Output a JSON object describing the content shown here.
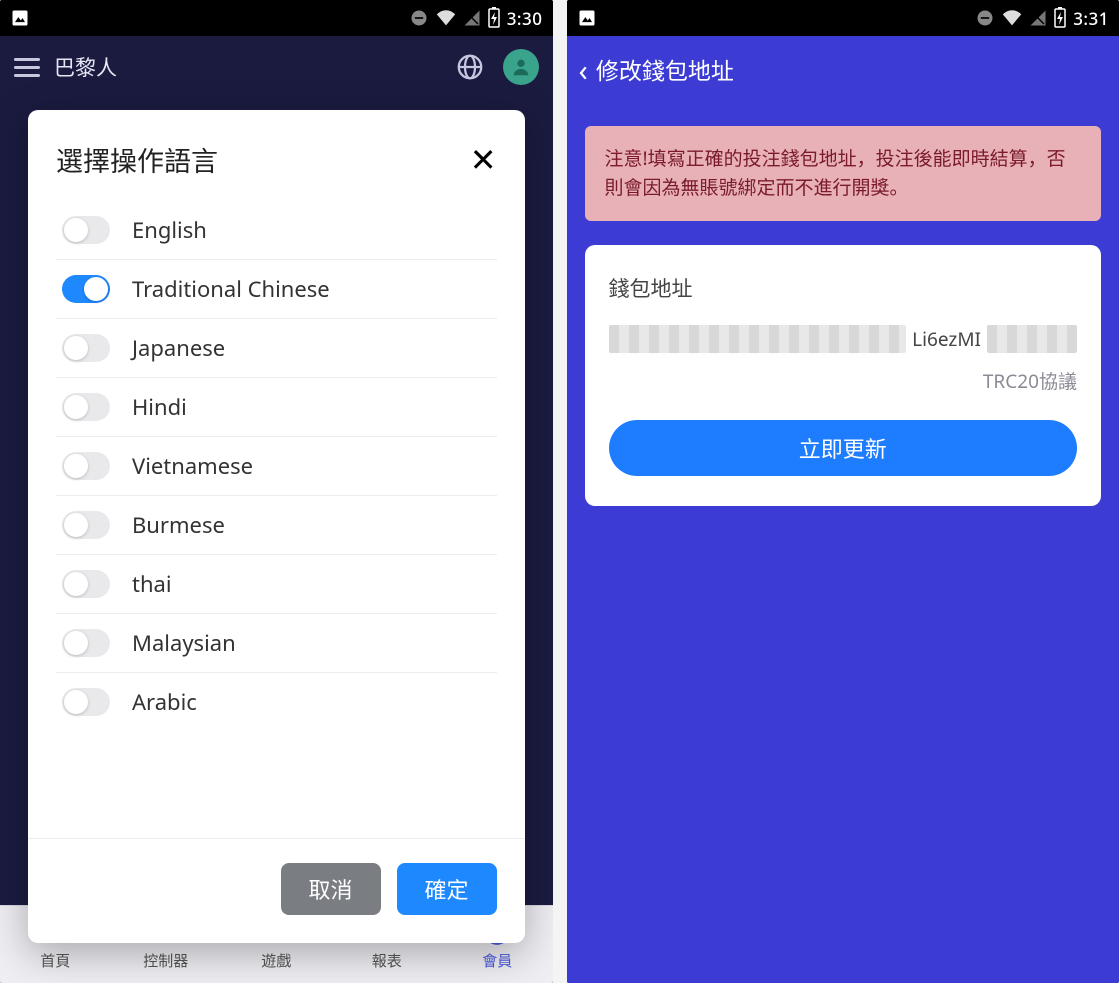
{
  "screen1": {
    "status": {
      "time": "3:30"
    },
    "header": {
      "app_name": "巴黎人"
    },
    "modal": {
      "title": "選擇操作語言",
      "languages": [
        {
          "label": "English",
          "on": false
        },
        {
          "label": "Traditional Chinese",
          "on": true
        },
        {
          "label": "Japanese",
          "on": false
        },
        {
          "label": "Hindi",
          "on": false
        },
        {
          "label": "Vietnamese",
          "on": false
        },
        {
          "label": "Burmese",
          "on": false
        },
        {
          "label": "thai",
          "on": false
        },
        {
          "label": "Malaysian",
          "on": false
        },
        {
          "label": "Arabic",
          "on": false
        }
      ],
      "cancel": "取消",
      "confirm": "確定"
    },
    "tabs": [
      {
        "label": "首頁",
        "icon": "home",
        "active": false
      },
      {
        "label": "控制器",
        "icon": "controller",
        "active": false
      },
      {
        "label": "遊戲",
        "icon": "gamepad",
        "active": false
      },
      {
        "label": "報表",
        "icon": "chart",
        "active": false
      },
      {
        "label": "會員",
        "icon": "user",
        "active": true
      }
    ]
  },
  "screen2": {
    "status": {
      "time": "3:31"
    },
    "page_title": "修改錢包地址",
    "notice": "注意!填寫正確的投注錢包地址，投注後能即時結算，否則會因為無賬號綁定而不進行開獎。",
    "wallet": {
      "label": "錢包地址",
      "address_visible_fragment": "Li6ezMI",
      "protocol": "TRC20協議",
      "update_button": "立即更新"
    }
  }
}
